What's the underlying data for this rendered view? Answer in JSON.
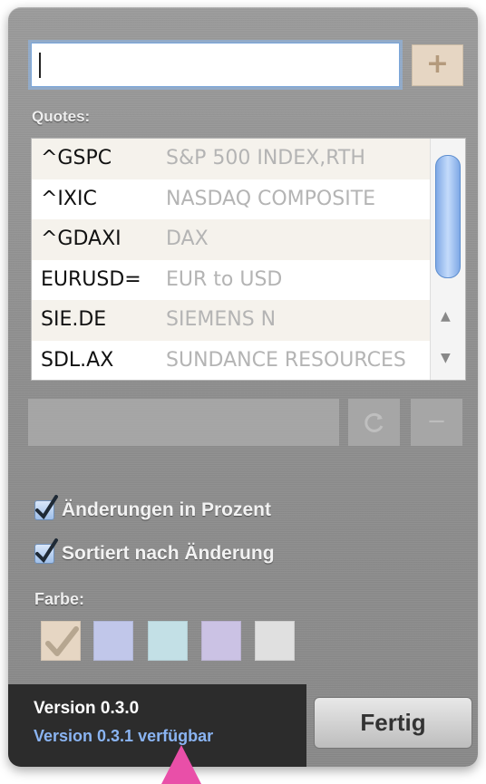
{
  "search": {
    "value": ""
  },
  "add_label": "+",
  "quotes_label": "Quotes:",
  "quotes": [
    {
      "symbol": "^GSPC",
      "name": "S&P 500 INDEX,RTH"
    },
    {
      "symbol": "^IXIC",
      "name": "NASDAQ COMPOSITE"
    },
    {
      "symbol": "^GDAXI",
      "name": "DAX"
    },
    {
      "symbol": "EURUSD=",
      "name": "EUR to USD"
    },
    {
      "symbol": "SIE.DE",
      "name": "SIEMENS N"
    },
    {
      "symbol": "SDL.AX",
      "name": "SUNDANCE RESOURCES"
    }
  ],
  "reload_icon": "reload-icon",
  "remove_label": "−",
  "options": {
    "percent_label": "Änderungen in Prozent",
    "percent_checked": true,
    "sort_label": "Sortiert nach Änderung",
    "sort_checked": true
  },
  "color_label": "Farbe:",
  "colors": [
    "#e6d6c3",
    "#c1c7ea",
    "#c3e0e6",
    "#cbc2e4",
    "#e0e0e0"
  ],
  "selected_color_index": 0,
  "version": "Version 0.3.0",
  "update": "Version 0.3.1 verfügbar",
  "done_label": "Fertig"
}
